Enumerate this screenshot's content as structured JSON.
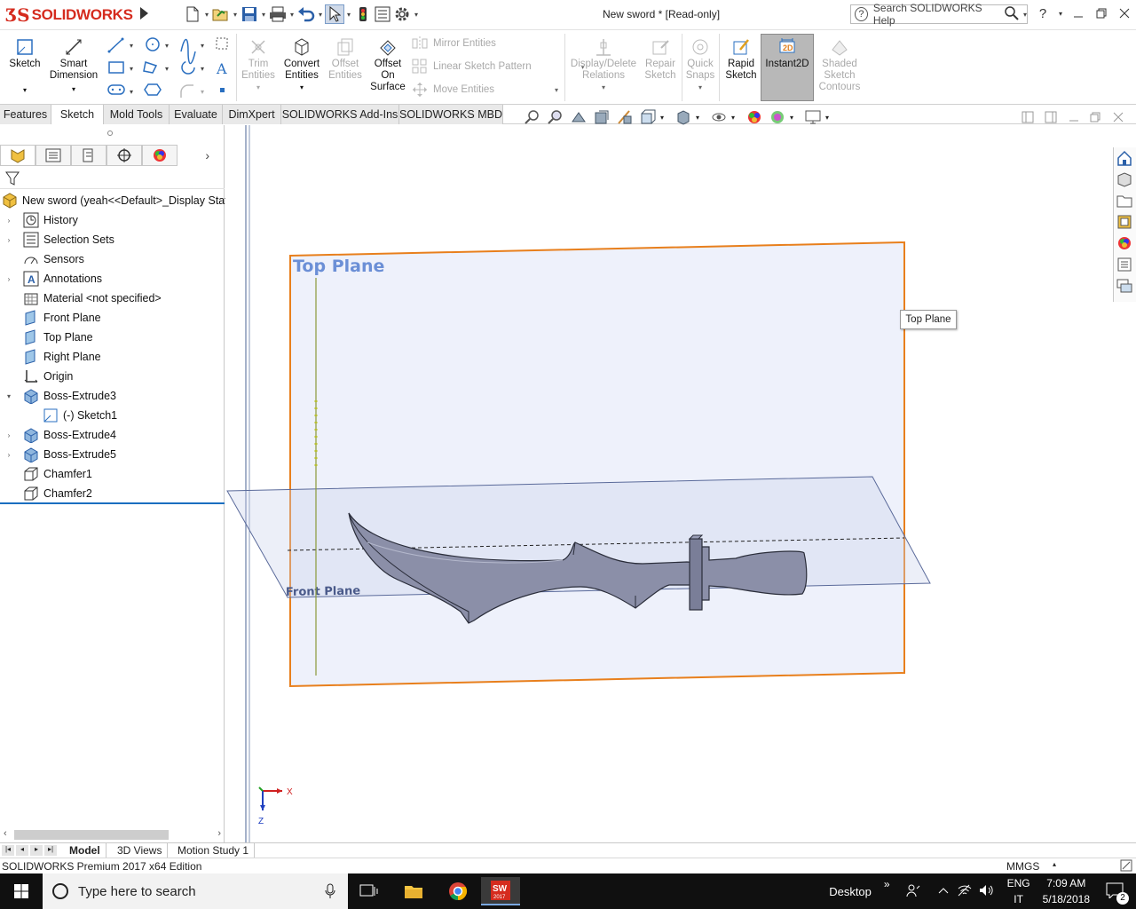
{
  "titlebar": {
    "logo_ds": "ƷS",
    "logo_name": "SOLIDWORKS",
    "document_title": "New sword * [Read-only]",
    "search_placeholder": "Search SOLIDWORKS Help",
    "help_label": "?"
  },
  "ribbon": {
    "sketch": "Sketch",
    "smart_dimension_1": "Smart",
    "smart_dimension_2": "Dimension",
    "trim_1": "Trim",
    "trim_2": "Entities",
    "convert_1": "Convert",
    "convert_2": "Entities",
    "offset_1": "Offset",
    "offset_2": "Entities",
    "offset_surface_1": "Offset",
    "offset_surface_2": "On",
    "offset_surface_3": "Surface",
    "mirror": "Mirror Entities",
    "linear_pattern": "Linear Sketch Pattern",
    "move": "Move Entities",
    "display_delete_1": "Display/Delete",
    "display_delete_2": "Relations",
    "repair_1": "Repair",
    "repair_2": "Sketch",
    "quick_snaps_1": "Quick",
    "quick_snaps_2": "Snaps",
    "rapid_sketch_1": "Rapid",
    "rapid_sketch_2": "Sketch",
    "instant2d": "Instant2D",
    "shaded_1": "Shaded",
    "shaded_2": "Sketch",
    "shaded_3": "Contours"
  },
  "tabs": [
    "Features",
    "Sketch",
    "Mold Tools",
    "Evaluate",
    "DimXpert",
    "SOLIDWORKS Add-Ins",
    "SOLIDWORKS MBD"
  ],
  "active_tab": "Sketch",
  "tree": {
    "root": "New sword  (yeah<<Default>_Display State",
    "items": [
      {
        "label": "History"
      },
      {
        "label": "Selection Sets"
      },
      {
        "label": "Sensors"
      },
      {
        "label": "Annotations"
      },
      {
        "label": "Material <not specified>"
      },
      {
        "label": "Front Plane"
      },
      {
        "label": "Top Plane"
      },
      {
        "label": "Right Plane"
      },
      {
        "label": "Origin"
      },
      {
        "label": "Boss-Extrude3"
      },
      {
        "label": "(-) Sketch1"
      },
      {
        "label": "Boss-Extrude4"
      },
      {
        "label": "Boss-Extrude5"
      },
      {
        "label": "Chamfer1"
      },
      {
        "label": "Chamfer2"
      }
    ]
  },
  "viewport": {
    "top_plane_label": "Top Plane",
    "front_plane_label": "Front Plane",
    "tooltip": "Top Plane",
    "axis_x": "X",
    "axis_z": "Z"
  },
  "bottom_tabs": [
    "Model",
    "3D Views",
    "Motion Study 1"
  ],
  "status": {
    "edition": "SOLIDWORKS Premium 2017 x64 Edition",
    "units": "MMGS"
  },
  "taskbar": {
    "search_placeholder": "Type here to search",
    "desktop": "Desktop",
    "lang_1": "ENG",
    "lang_2": "IT",
    "time": "7:09 AM",
    "date": "5/18/2018",
    "notifications": "2",
    "sw_badge": "SW",
    "sw_year": "2017"
  },
  "colors": {
    "brand": "#d52b1e",
    "plane_edge": "#e87f1c",
    "plane_fill": "#eef1fb",
    "plane_label": "#6b8fd6",
    "sword": "#8b8fa8"
  }
}
